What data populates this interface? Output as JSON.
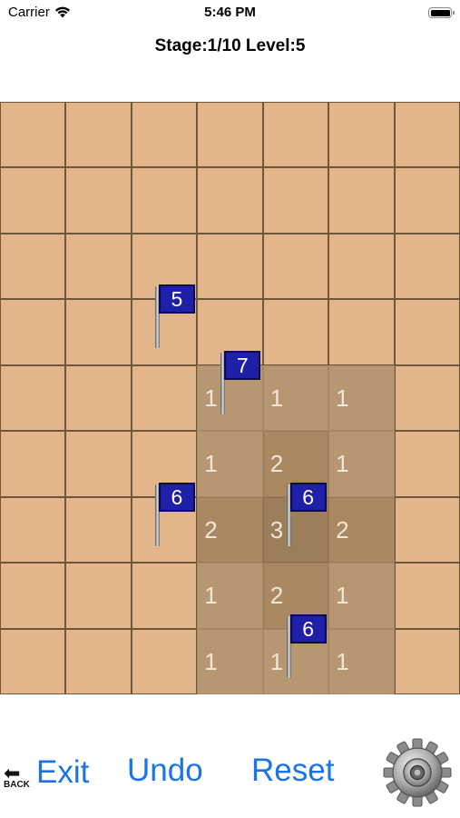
{
  "status_bar": {
    "carrier": "Carrier",
    "time": "5:46 PM"
  },
  "header": {
    "stage": "Stage:1/10 Level:5"
  },
  "board": {
    "cols": 7,
    "rows": 9,
    "dug_cells": [
      {
        "r": 4,
        "c": 3,
        "shade": 1
      },
      {
        "r": 4,
        "c": 4,
        "shade": 1
      },
      {
        "r": 4,
        "c": 5,
        "shade": 1
      },
      {
        "r": 5,
        "c": 3,
        "shade": 1
      },
      {
        "r": 5,
        "c": 4,
        "shade": 2
      },
      {
        "r": 5,
        "c": 5,
        "shade": 1
      },
      {
        "r": 6,
        "c": 3,
        "shade": 2
      },
      {
        "r": 6,
        "c": 4,
        "shade": 3
      },
      {
        "r": 6,
        "c": 5,
        "shade": 2
      },
      {
        "r": 7,
        "c": 3,
        "shade": 1
      },
      {
        "r": 7,
        "c": 4,
        "shade": 2
      },
      {
        "r": 7,
        "c": 5,
        "shade": 1
      },
      {
        "r": 8,
        "c": 3,
        "shade": 1
      },
      {
        "r": 8,
        "c": 4,
        "shade": 1
      },
      {
        "r": 8,
        "c": 5,
        "shade": 1
      }
    ],
    "numbers": [
      {
        "r": 4,
        "c": 3,
        "value": "1"
      },
      {
        "r": 4,
        "c": 4,
        "value": "1"
      },
      {
        "r": 4,
        "c": 5,
        "value": "1"
      },
      {
        "r": 5,
        "c": 3,
        "value": "1"
      },
      {
        "r": 5,
        "c": 4,
        "value": "2"
      },
      {
        "r": 5,
        "c": 5,
        "value": "1"
      },
      {
        "r": 6,
        "c": 3,
        "value": "2"
      },
      {
        "r": 6,
        "c": 4,
        "value": "3"
      },
      {
        "r": 6,
        "c": 5,
        "value": "2"
      },
      {
        "r": 7,
        "c": 3,
        "value": "1"
      },
      {
        "r": 7,
        "c": 4,
        "value": "2"
      },
      {
        "r": 7,
        "c": 5,
        "value": "1"
      },
      {
        "r": 8,
        "c": 3,
        "value": "1"
      },
      {
        "r": 8,
        "c": 4,
        "value": "1"
      },
      {
        "r": 8,
        "c": 5,
        "value": "1"
      }
    ],
    "flags": [
      {
        "r": 3,
        "c": 2,
        "value": "5"
      },
      {
        "r": 4,
        "c": 3,
        "value": "7"
      },
      {
        "r": 6,
        "c": 2,
        "value": "6"
      },
      {
        "r": 6,
        "c": 4,
        "value": "6"
      },
      {
        "r": 8,
        "c": 4,
        "value": "6"
      }
    ]
  },
  "controls": {
    "back_icon_label": "BACK",
    "exit_label": "Exit",
    "undo_label": "Undo",
    "reset_label": "Reset",
    "settings_icon": "gear-icon"
  }
}
